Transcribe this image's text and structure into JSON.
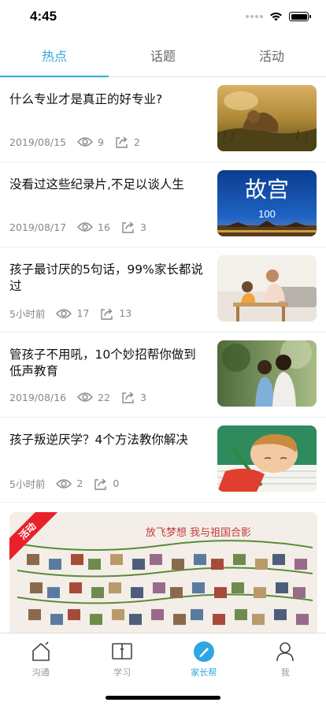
{
  "status_bar": {
    "time": "4:45",
    "icons": [
      "signal-dots-icon",
      "wifi-icon",
      "battery-icon"
    ]
  },
  "top_tabs": [
    {
      "label": "热点",
      "active": true
    },
    {
      "label": "话题",
      "active": false
    },
    {
      "label": "活动",
      "active": false
    }
  ],
  "articles": [
    {
      "title": "什么专业才是真正的好专业?",
      "date": "2019/08/15",
      "views": "9",
      "shares": "2",
      "image": "lion-on-grass-photo"
    },
    {
      "title": "没看过这些纪录片,不足以谈人生",
      "date": "2019/08/17",
      "views": "16",
      "shares": "3",
      "image": "forbidden-city-poster",
      "image_text": {
        "title": "故宫",
        "subtitle": "100"
      }
    },
    {
      "title": "孩子最讨厌的5句话，99%家长都说过",
      "date": "5小时前",
      "views": "17",
      "shares": "13",
      "image": "mother-and-child-photo"
    },
    {
      "title": "管孩子不用吼，10个妙招帮你做到低声教育",
      "date": "2019/08/16",
      "views": "22",
      "shares": "3",
      "image": "mother-and-daughter-outdoor-photo"
    },
    {
      "title": "孩子叛逆厌学？4个方法教你解决",
      "date": "5小时前",
      "views": "2",
      "shares": "0",
      "image": "boy-sleeping-on-desk-photo"
    }
  ],
  "banner": {
    "ribbon": "活动",
    "image": "photo-wall-activity-banner",
    "image_text": "放飞梦想  我与祖国合影"
  },
  "bottom_nav": [
    {
      "label": "沟通",
      "icon": "house-icon",
      "active": false
    },
    {
      "label": "学习",
      "icon": "book-icon",
      "active": false
    },
    {
      "label": "家长帮",
      "icon": "compass-icon",
      "active": true
    },
    {
      "label": "我",
      "icon": "person-icon",
      "active": false
    }
  ],
  "colors": {
    "accent": "#2ea7e0",
    "ribbon": "#e8212b",
    "meta_text": "#888888"
  }
}
